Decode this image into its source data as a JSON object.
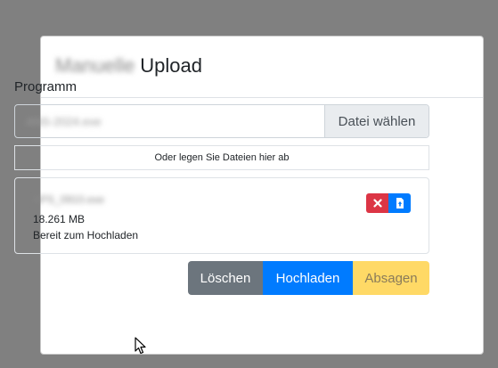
{
  "modal": {
    "title_blurred": "Manuelle",
    "title": "Upload"
  },
  "form": {
    "label": "Programm",
    "file_input_value": "ANS-2024.exe",
    "browse_label": "Datei wählen",
    "drop_hint": "Oder legen Sie Dateien hier ab"
  },
  "file_card": {
    "name": "APS_0910.exe",
    "size": "18.261 MB",
    "status": "Bereit zum Hochladen",
    "remove_icon": "close-icon",
    "upload_icon": "file-upload-icon"
  },
  "footer": {
    "clear_label": "Löschen",
    "upload_label": "Hochladen",
    "cancel_label": "Absagen"
  },
  "colors": {
    "backdrop": "#808080",
    "primary": "#007bff",
    "danger": "#dc3545",
    "secondary": "#6c757d",
    "warning": "#ffd966"
  }
}
